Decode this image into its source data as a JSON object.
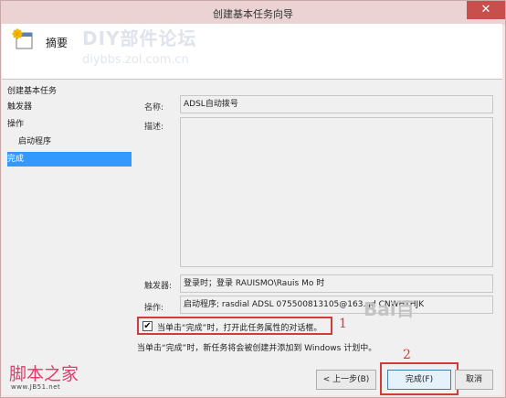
{
  "window": {
    "title": "创建基本任务向导",
    "close_glyph": "✕"
  },
  "header": {
    "title": "摘要",
    "watermark_line1": "DIY部件论坛",
    "watermark_line2": "diybbs.zol.com.cn"
  },
  "nav": {
    "items": [
      {
        "label": "创建基本任务"
      },
      {
        "label": "触发器"
      },
      {
        "label": "操作"
      },
      {
        "label": "启动程序"
      },
      {
        "label": "完成"
      }
    ]
  },
  "form": {
    "name_label": "名称:",
    "name_value": "ADSL自动拨号",
    "desc_label": "描述:",
    "desc_value": "",
    "trigger_label": "触发器:",
    "trigger_value": "登录时；登录 RAUISMO\\Rauis Mo 时",
    "action_label": "操作:",
    "action_value": "启动程序; rasdial ADSL 075500813105@163.gd CNWHTHJK"
  },
  "checkbox": {
    "label": "当单击“完成”时，打开此任务属性的对话框。",
    "checked": true,
    "check_glyph": "✔"
  },
  "annotations": {
    "marker1": "1",
    "marker2": "2"
  },
  "info_text": "当单击“完成”时，新任务将会被创建并添加到 Windows 计划中。",
  "buttons": {
    "back": "< 上一步(B)",
    "finish": "完成(F)",
    "cancel": "取消"
  },
  "watermarks": {
    "site_cn": "脚本之家",
    "site_url": "www.JB51.net",
    "baidu": "Bai百"
  },
  "colors": {
    "selected_nav": "#3399ff",
    "annotation_red": "#d33a3a"
  }
}
